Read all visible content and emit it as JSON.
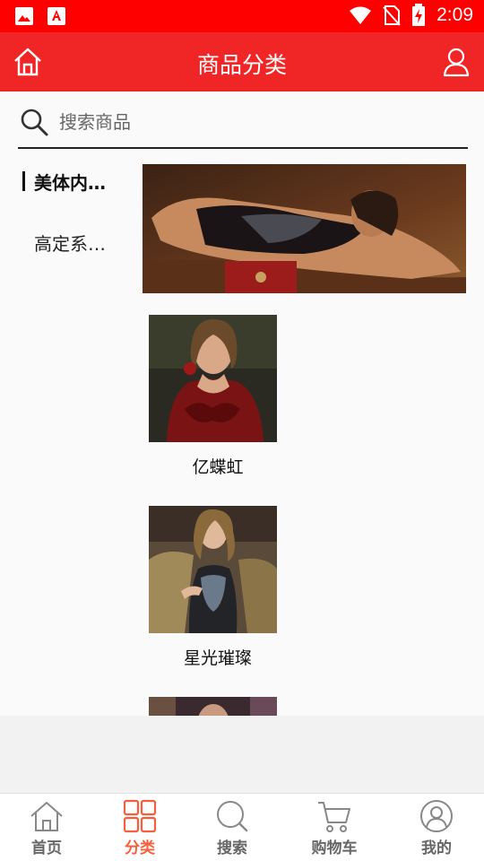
{
  "status_bar": {
    "time": "2:09"
  },
  "header": {
    "title": "商品分类"
  },
  "search": {
    "placeholder": "搜索商品"
  },
  "categories": [
    {
      "label": "美体内…",
      "active": true
    },
    {
      "label": "高定系…",
      "active": false
    }
  ],
  "products": [
    {
      "name": "亿蝶虹"
    },
    {
      "name": "星光璀璨"
    }
  ],
  "tabs": [
    {
      "label": "首页",
      "icon": "home-icon",
      "active": false
    },
    {
      "label": "分类",
      "icon": "grid-icon",
      "active": true
    },
    {
      "label": "搜索",
      "icon": "search-icon",
      "active": false
    },
    {
      "label": "购物车",
      "icon": "cart-icon",
      "active": false
    },
    {
      "label": "我的",
      "icon": "user-icon",
      "active": false
    }
  ],
  "colors": {
    "status_bar": "#ff0000",
    "header": "#f02626",
    "tab_active": "#f65e3d"
  }
}
